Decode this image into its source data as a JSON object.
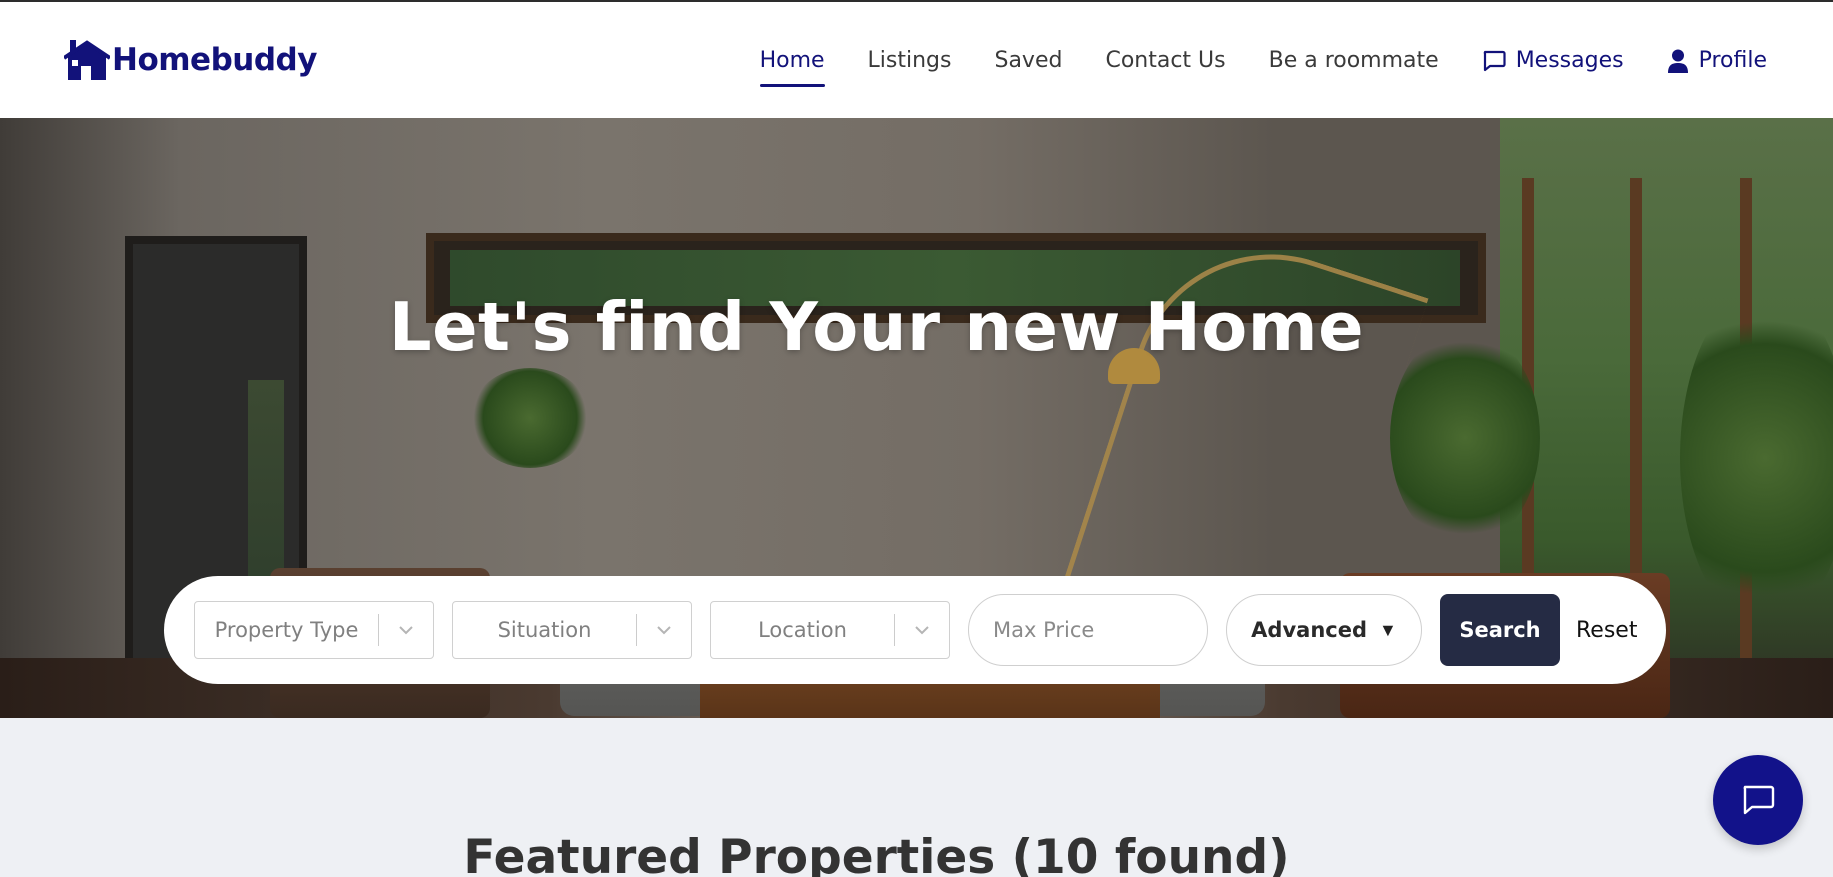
{
  "header": {
    "brand": "Homebuddy",
    "nav": [
      {
        "label": "Home",
        "active": true
      },
      {
        "label": "Listings"
      },
      {
        "label": "Saved"
      },
      {
        "label": "Contact Us"
      },
      {
        "label": "Be a roommate"
      },
      {
        "label": "Messages",
        "icon": "chat-bubble-icon"
      },
      {
        "label": "Profile",
        "icon": "user-icon"
      }
    ]
  },
  "hero": {
    "title": "Let's find Your new Home"
  },
  "search": {
    "property_type_placeholder": "Property Type",
    "situation_placeholder": "Situation",
    "location_placeholder": "Location",
    "max_price_placeholder": "Max Price",
    "advanced_label": "Advanced",
    "advanced_caret": "▼",
    "search_label": "Search",
    "reset_label": "Reset"
  },
  "featured": {
    "heading": "Featured Properties (10 found)"
  },
  "colors": {
    "brand": "#12127a",
    "search_button": "#252b44",
    "page_background": "#eef0f4"
  }
}
